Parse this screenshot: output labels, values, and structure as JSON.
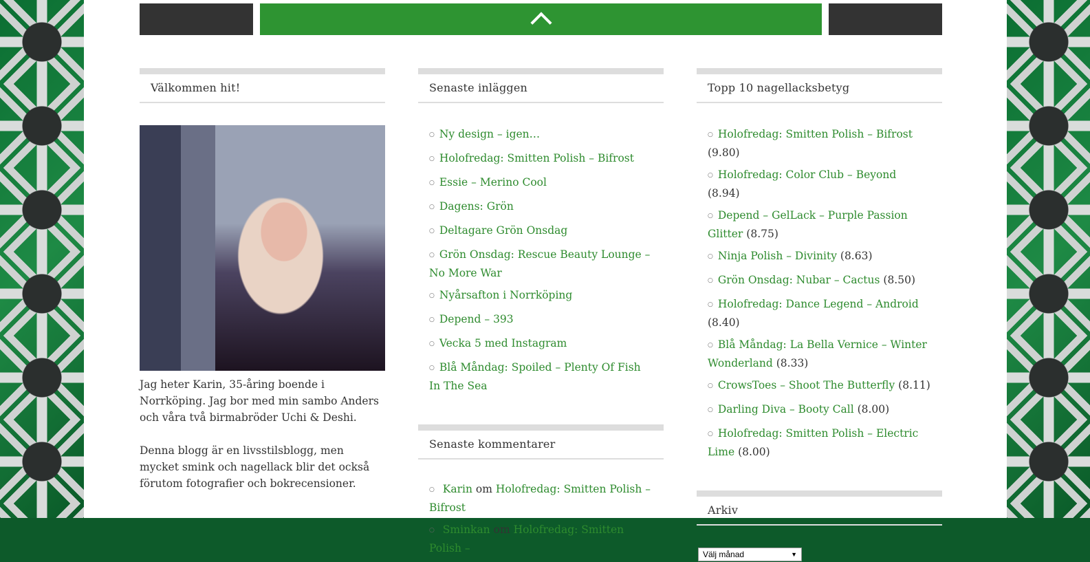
{
  "about": {
    "title": "Välkommen hit!",
    "p1": "Jag heter Karin, 35-åring boende i Norrköping. Jag bor med min sambo Anders och våra två birmabröder Uchi & Deshi.",
    "p2": "Denna blogg är en livsstilsblogg, men mycket smink och nagellack blir det också förutom fotografier och bokrecensioner."
  },
  "recent_posts": {
    "title": "Senaste inläggen",
    "items": [
      "Ny design – igen…",
      "Holofredag: Smitten Polish – Bifrost",
      "Essie – Merino Cool",
      "Dagens: Grön",
      "Deltagare Grön Onsdag",
      "Grön Onsdag: Rescue Beauty Lounge – No More War",
      "Nyårsafton i Norrköping",
      "Depend – 393",
      "Vecka 5 med Instagram",
      "Blå Måndag: Spoiled – Plenty Of Fish In The Sea"
    ]
  },
  "recent_comments": {
    "title": "Senaste kommentarer",
    "items": [
      {
        "author": "Karin",
        "om": "om",
        "post": "Holofredag: Smitten Polish – Bifrost"
      },
      {
        "author": "Sminkan",
        "om": "om",
        "post": "Holofredag: Smitten Polish –"
      }
    ]
  },
  "top10": {
    "title": "Topp 10 nagellacksbetyg",
    "items": [
      {
        "name": "Holofredag: Smitten Polish – Bifrost",
        "score": "(9.80)"
      },
      {
        "name": "Holofredag: Color Club – Beyond",
        "score": "(8.94)"
      },
      {
        "name": "Depend – GelLack – Purple Passion Glitter",
        "score": "(8.75)"
      },
      {
        "name": "Ninja Polish – Divinity",
        "score": "(8.63)"
      },
      {
        "name": "Grön Onsdag: Nubar – Cactus",
        "score": "(8.50)"
      },
      {
        "name": "Holofredag: Dance Legend – Android",
        "score": "(8.40)"
      },
      {
        "name": "Blå Måndag: La Bella Vernice – Winter Wonderland",
        "score": "(8.33)"
      },
      {
        "name": "CrowsToes – Shoot The Butterfly",
        "score": "(8.11)"
      },
      {
        "name": "Darling Diva – Booty Call",
        "score": "(8.00)"
      },
      {
        "name": "Holofredag: Smitten Polish – Electric Lime",
        "score": "(8.00)"
      }
    ]
  },
  "archive": {
    "title": "Arkiv",
    "select_value": "Välj månad"
  },
  "colors": {
    "accent": "#2e9432",
    "dark": "#333333",
    "link": "#2e8b2e"
  },
  "icons": {
    "scroll_top": "chevron-up-icon"
  }
}
